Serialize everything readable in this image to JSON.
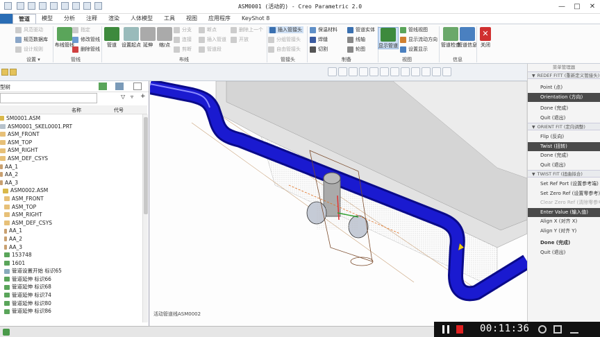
{
  "window": {
    "title": "ASM0001 (活动的) - Creo Parametric 2.0",
    "controls": [
      "minimize-icon",
      "maximize-icon",
      "close-icon"
    ]
  },
  "tabs": [
    "管道",
    "模型",
    "分析",
    "注释",
    "渲染",
    "人体模型",
    "工具",
    "视图",
    "应用程序",
    "KeyShot 8"
  ],
  "ribbon": {
    "setup": {
      "items": [
        "风范驱动",
        "规范数据库",
        "设计规则"
      ],
      "label": "设置",
      "dropdown": "▾"
    },
    "piping": {
      "items": [
        "指定",
        "修改管线",
        "删除管线"
      ],
      "big": "布线管线",
      "label": "管线"
    },
    "route": {
      "items": [
        "分支",
        "连接",
        "剪断"
      ],
      "items2": [
        "断点",
        "插入管道",
        "管道段"
      ],
      "items3": [
        "删除上一个",
        "开放"
      ],
      "big": [
        "管道",
        "设置起点",
        "延伸",
        "缩/点"
      ],
      "label": "布线"
    },
    "fitting": {
      "items": [
        "插入管接头",
        "分组管接头",
        "自由管接头"
      ],
      "label": "管接头"
    },
    "mfg": {
      "items": [
        "保温材料",
        "焊缝",
        "切割"
      ],
      "items2": [
        "管道实体",
        "线轴",
        "轮图"
      ],
      "label": "制备"
    },
    "view": {
      "items": [
        "管线视图",
        "显示流动方向",
        "设置显示"
      ],
      "big": "显示管道",
      "label": "视图"
    },
    "info": {
      "big": [
        "管道检查",
        "管道信息"
      ],
      "label": "信息"
    },
    "close": {
      "label": "关闭",
      "group": "关闭"
    }
  },
  "tree": {
    "header": "型树",
    "col_name": "名称",
    "col_id": "代号",
    "nodes": [
      "SM0001.ASM",
      "ASM0001_SKEL0001.PRT",
      "ASM_FRONT",
      "ASM_TOP",
      "ASM_RIGHT",
      "ASM_DEF_CSYS",
      "AA_1",
      "AA_2",
      "AA_3",
      "ASM0002.ASM",
      "ASM_FRONT",
      "ASM_TOP",
      "ASM_RIGHT",
      "ASM_DEF_CSYS",
      "AA_1",
      "AA_2",
      "AA_3",
      "153748",
      "1601",
      "管道设置开始 标识65",
      "管道延伸 标识66",
      "管道延伸 标识68",
      "管道延伸 标识74",
      "管道延伸 标识80",
      "管道延伸 标识86"
    ]
  },
  "status": "活动管道线ASM0002",
  "menu": {
    "header": "菜单管理器",
    "sections": [
      {
        "title": "REDEF FITT (重新定义管接头)",
        "items": [
          {
            "label": "Point (点)",
            "state": "normal"
          },
          {
            "label": "Orientation (方向)",
            "state": "selected"
          },
          {
            "label": "Done (完成)",
            "state": "normal"
          },
          {
            "label": "Quit (退出)",
            "state": "normal"
          }
        ]
      },
      {
        "title": "ORIENT FIT (定向调整)",
        "items": [
          {
            "label": "Flip (反向)",
            "state": "normal"
          },
          {
            "label": "Twist (扭转)",
            "state": "selected"
          },
          {
            "label": "Done (完成)",
            "state": "normal"
          },
          {
            "label": "Quit (退出)",
            "state": "normal"
          }
        ]
      },
      {
        "title": "TWIST FIT (扭曲拟合)",
        "items": [
          {
            "label": "Set Ref Port (设置参考端)",
            "state": "normal"
          },
          {
            "label": "Set Zero Ref (设置零参考)",
            "state": "normal"
          },
          {
            "label": "Clear Zero Ref (清除零参考)",
            "state": "disabled"
          },
          {
            "label": "Enter Value (输入值)",
            "state": "selected"
          },
          {
            "label": "Align X (对齐 X)",
            "state": "normal"
          },
          {
            "label": "Align Y (对齐 Y)",
            "state": "normal"
          },
          {
            "label": "Done (完成)",
            "state": "bold"
          },
          {
            "label": "Quit (退出)",
            "state": "normal"
          }
        ]
      }
    ]
  },
  "recorder": {
    "time": "00:11:36"
  },
  "colors": {
    "pipe": "#1a1ad0",
    "selected_menu": "#4a4a4a",
    "accent": "#2a6db5"
  }
}
